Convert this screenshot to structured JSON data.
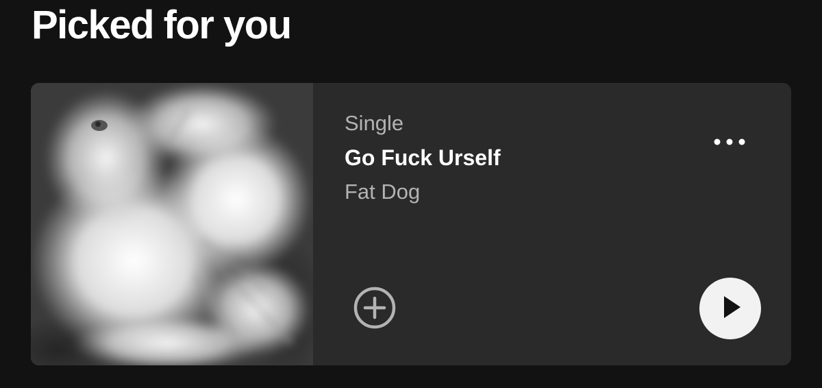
{
  "section": {
    "title": "Picked for you"
  },
  "card": {
    "type_label": "Single",
    "title": "Go Fuck Urself",
    "artist": "Fat Dog",
    "icons": {
      "more": "more-horizontal-icon",
      "add": "plus-circle-icon",
      "play": "play-icon"
    }
  },
  "colors": {
    "background": "#121212",
    "card_background": "#2a2a2a",
    "primary_text": "#ffffff",
    "secondary_text": "#b3b3b3",
    "play_button_background": "#f2f2f2",
    "play_icon": "#121212"
  }
}
